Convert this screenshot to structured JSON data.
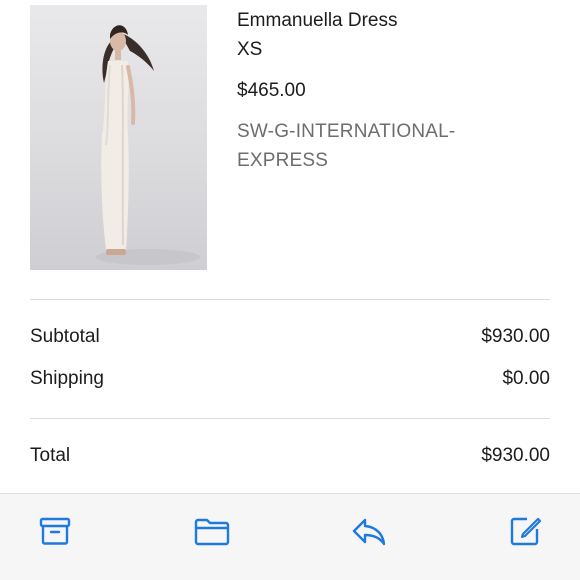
{
  "product": {
    "name": "Emmanuella Dress",
    "size": "XS",
    "price": "$465.00",
    "shipping_method_line1": "SW-G-INTERNATIONAL-",
    "shipping_method_line2": "EXPRESS"
  },
  "summary": {
    "subtotal_label": "Subtotal",
    "subtotal_value": "$930.00",
    "shipping_label": "Shipping",
    "shipping_value": "$0.00",
    "total_label": "Total",
    "total_value": "$930.00"
  },
  "toolbar": {
    "accent_color": "#1f7ae0",
    "buttons": [
      {
        "icon": "archive-icon"
      },
      {
        "icon": "folder-icon"
      },
      {
        "icon": "reply-icon"
      },
      {
        "icon": "compose-icon"
      }
    ]
  }
}
